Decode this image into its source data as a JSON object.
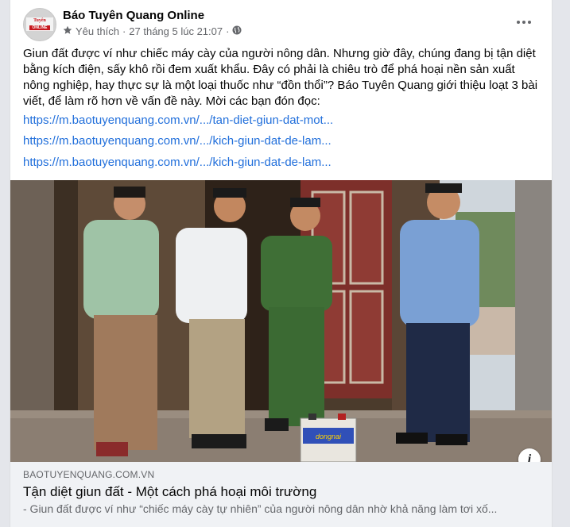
{
  "post": {
    "page_name": "Báo Tuyên Quang Online",
    "avatar_logo_top": "Tuyên Quang",
    "avatar_logo_bottom": "ONLINE",
    "meta": {
      "favorite_label": "Yêu thích",
      "separator": "·",
      "timestamp": "27 tháng 5 lúc 21:07",
      "separator2": "·",
      "privacy_icon": "globe-icon"
    },
    "more_icon": "more-horizontal-icon",
    "text": "Giun đất được ví như chiếc máy cày của người nông dân. Nhưng giờ đây, chúng đang bị tận diệt bằng kích điện, sấy khô rồi đem xuất khẩu. Đây có phải là chiêu trò để phá hoại nền sản xuất nông nghiệp, hay thực sự là một loại thuốc như “đồn thổi”? Báo Tuyên Quang giới thiệu loạt 3 bài viết, để làm rõ hơn về vấn đề này. Mời các bạn đón đọc:",
    "links": [
      "https://m.baotuyenquang.com.vn/.../tan-diet-giun-dat-mot...",
      "https://m.baotuyenquang.com.vn/.../kich-giun-dat-de-lam...",
      "https://m.baotuyenquang.com.vn/.../kich-giun-dat-de-lam..."
    ],
    "photo": {
      "battery_label": "dongnai"
    },
    "info_icon": "info-icon",
    "preview": {
      "domain": "BAOTUYENQUANG.COM.VN",
      "title": "Tận diệt giun đất - Một cách phá hoại môi trường",
      "description": "- Giun đất được ví như “chiếc máy cày tự nhiên” của người nông dân nhờ khả năng làm tơi xố..."
    }
  },
  "colors": {
    "link": "#216fdb",
    "secondary_text": "#65676b",
    "preview_bg": "#f0f2f5",
    "page_bg": "#e4e6eb"
  }
}
